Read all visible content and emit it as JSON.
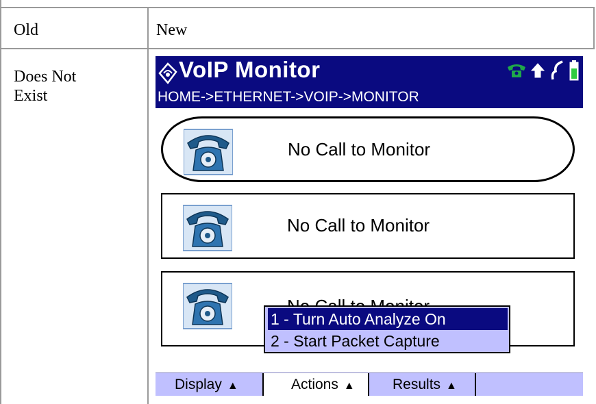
{
  "table": {
    "headers": {
      "old": "Old",
      "new": "New"
    },
    "row": {
      "old_text_line1": "Does Not",
      "old_text_line2": "Exist"
    }
  },
  "device": {
    "title": "VoIP Monitor",
    "breadcrumb": "HOME->ETHERNET->VOIP->MONITOR",
    "status_icons": [
      "phone-icon",
      "upload-arrow-icon",
      "power-plug-icon",
      "battery-icon"
    ],
    "calls": [
      {
        "label": "No Call to Monitor",
        "selected": true
      },
      {
        "label": "No Call to Monitor",
        "selected": false
      },
      {
        "label": "No Call to Monitor",
        "selected": false
      }
    ],
    "softkeys": {
      "display": "Display",
      "actions": "Actions",
      "results": "Results"
    },
    "actions_menu": {
      "items": [
        "1 - Turn Auto Analyze On",
        "2 - Start Packet Capture"
      ],
      "highlighted_index": 0
    },
    "colors": {
      "titlebar": "#0a0a80",
      "softkey_bar": "#c0c0ff",
      "menu_highlight": "#0a0a80"
    }
  }
}
